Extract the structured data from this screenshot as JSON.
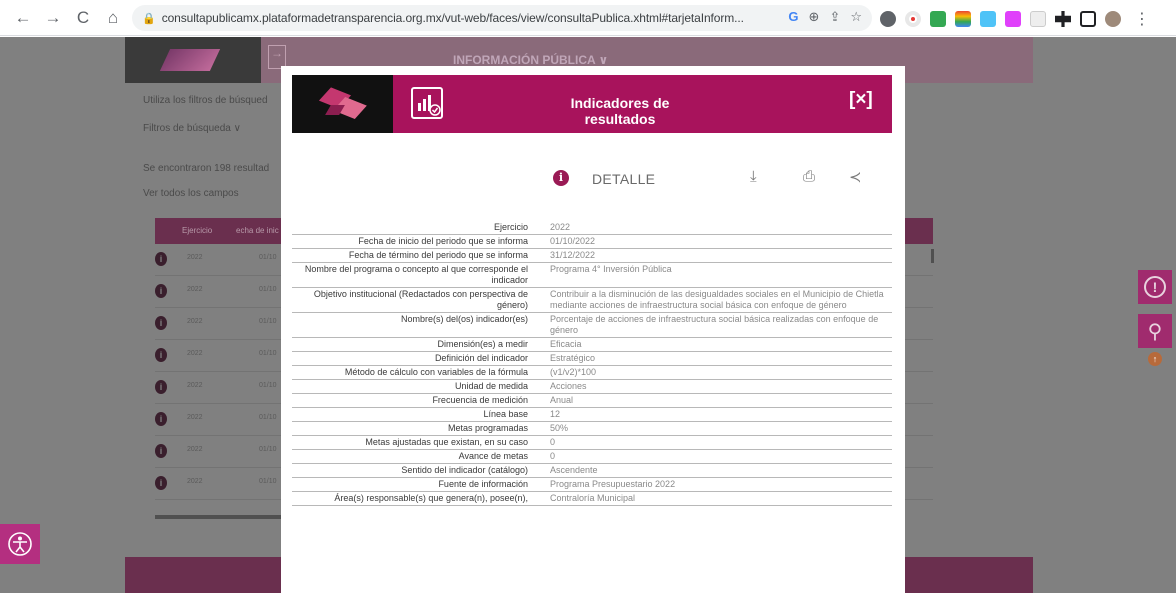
{
  "browser": {
    "url": "consultapublicamx.plataformadetransparencia.org.mx/vut-web/faces/view/consultaPublica.xhtml#tarjetaInform...",
    "back": "←",
    "forward": "→",
    "reload": "C",
    "home": "⌂",
    "lock": "🔒",
    "omni_g": "G",
    "omni_zoom": "⊕",
    "omni_share": "⇪",
    "omni_star": "☆",
    "menu": "⋮"
  },
  "page": {
    "header_title": "INFORMACIÓN PÚBLICA ∨",
    "filter_hint": "Utiliza los filtros de búsqued",
    "filters_label": "Filtros de búsqueda ∨",
    "results_text": "Se encontraron 198 resultad",
    "see_all": "Ver todos los campos",
    "col_ejercicio": "Ejercicio",
    "col_fecha": "echa de inic",
    "rows": [
      {
        "year": "2022",
        "date": "01/10"
      },
      {
        "year": "2022",
        "date": "01/10"
      },
      {
        "year": "2022",
        "date": "01/10"
      },
      {
        "year": "2022",
        "date": "01/10"
      },
      {
        "year": "2022",
        "date": "01/10"
      },
      {
        "year": "2022",
        "date": "01/10"
      },
      {
        "year": "2022",
        "date": "01/10"
      },
      {
        "year": "2022",
        "date": "01/10"
      }
    ],
    "row_icon": "i"
  },
  "modal": {
    "title": "Indicadores de resultados",
    "close": "[×]",
    "detail": "DETALLE",
    "info_glyph": "i",
    "download_glyph": "⤓",
    "print_glyph": "⎙",
    "share_glyph": "≺",
    "fields": [
      {
        "label": "Ejercicio",
        "value": "2022"
      },
      {
        "label": "Fecha de inicio del periodo que se informa",
        "value": "01/10/2022"
      },
      {
        "label": "Fecha de término del periodo que se informa",
        "value": "31/12/2022"
      },
      {
        "label": "Nombre del programa o concepto al que corresponde el indicador",
        "value": "Programa 4° Inversión Pública"
      },
      {
        "label": "Objetivo institucional (Redactados con perspectiva de género)",
        "value": "Contribuir a la disminución de las desigualdades sociales en el Municipio de Chietla mediante acciones de infraestructura social básica con enfoque de género"
      },
      {
        "label": "Nombre(s) del(os) indicador(es)",
        "value": "Porcentaje de acciones de infraestructura social básica realizadas con enfoque de género"
      },
      {
        "label": "Dimensión(es) a medir",
        "value": "Eficacia"
      },
      {
        "label": "Definición del indicador",
        "value": "Estratégico"
      },
      {
        "label": "Método de cálculo con variables de la fórmula",
        "value": "(v1/v2)*100"
      },
      {
        "label": "Unidad de medida",
        "value": "Acciones"
      },
      {
        "label": "Frecuencia de medición",
        "value": "Anual"
      },
      {
        "label": "Línea base",
        "value": "12"
      },
      {
        "label": "Metas programadas",
        "value": "50%"
      },
      {
        "label": "Metas ajustadas que existan, en su caso",
        "value": "0"
      },
      {
        "label": "Avance de metas",
        "value": "0"
      },
      {
        "label": "Sentido del indicador (catálogo)",
        "value": "Ascendente"
      },
      {
        "label": "Fuente de información",
        "value": "Programa Presupuestario 2022"
      },
      {
        "label": "Área(s) responsable(s) que genera(n), posee(n),",
        "value": "Contraloría Municipal"
      }
    ]
  },
  "side": {
    "alert_glyph": "!",
    "search_glyph": "⚲",
    "dot_glyph": "↑"
  },
  "colors": {
    "brand": "#a8135c",
    "brand_dark": "#6a2f4e"
  }
}
